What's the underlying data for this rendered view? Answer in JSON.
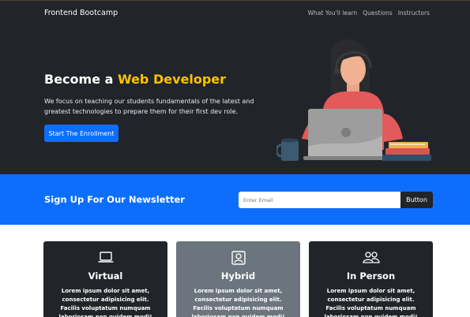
{
  "nav": {
    "brand": "Frontend Bootcamp",
    "links": [
      "What You'll learn",
      "Questions",
      "Instructors"
    ]
  },
  "hero": {
    "title_plain": "Become a ",
    "title_accent": "Web Developer",
    "description": "We focus on teaching our students fundamentals of the latest and greatest technologies to prepare them for their first dev role.",
    "button_label": "Start The Enrollment"
  },
  "newsletter": {
    "title": "Sign Up For Our Newsletter",
    "input_placeholder": "Enter Email",
    "button_label": "Button"
  },
  "cards": [
    {
      "icon": "laptop-icon",
      "title": "Virtual",
      "text": "Lorem ipsum dolor sit amet, consectetur adipisicing elit. Facilis voluptatum numquam laboriosam non quidem modi!"
    },
    {
      "icon": "person-badge-icon",
      "title": "Hybrid",
      "text": "Lorem ipsum dolor sit amet, consectetur adipisicing elit. Facilis voluptatum numquam laboriosam non quidem modi!"
    },
    {
      "icon": "people-icon",
      "title": "In Person",
      "text": "Lorem ipsum dolor sit amet, consectetur adipisicing elit. Facilis voluptatum numquam laboriosam non quidem modi!"
    }
  ],
  "colors": {
    "dark": "#212529",
    "primary": "#0d6efd",
    "accent": "#ffc107",
    "gray": "#6c757d"
  }
}
